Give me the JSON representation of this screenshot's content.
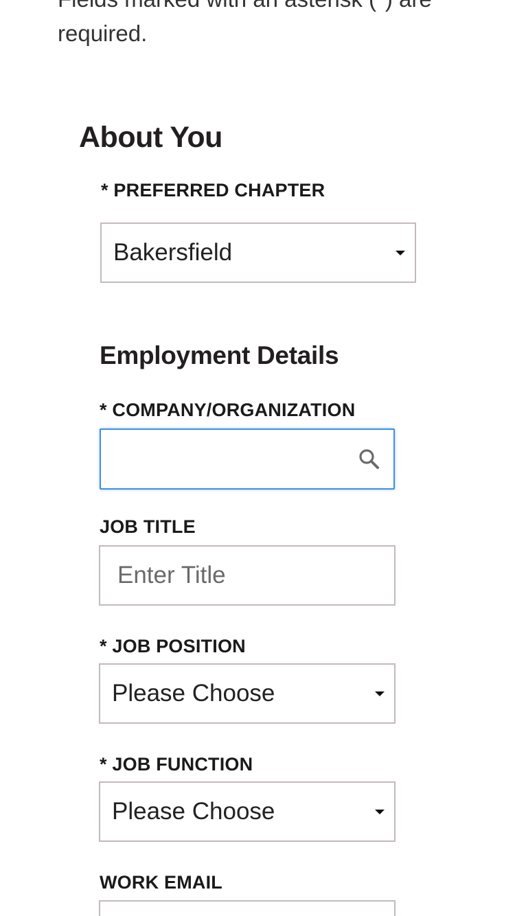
{
  "intro": {
    "required_note": "Fields marked with an asterisk (*) are required."
  },
  "about_you": {
    "heading": "About You",
    "preferred_chapter": {
      "label": "* PREFERRED CHAPTER",
      "value": "Bakersfield"
    }
  },
  "employment": {
    "heading": "Employment Details",
    "company": {
      "label": "* COMPANY/ORGANIZATION",
      "value": ""
    },
    "job_title": {
      "label": "JOB TITLE",
      "placeholder": "Enter Title"
    },
    "job_position": {
      "label": "* JOB POSITION",
      "value": "Please Choose"
    },
    "job_function": {
      "label": "* JOB FUNCTION",
      "value": "Please Choose"
    },
    "work_email": {
      "label": "WORK EMAIL"
    }
  },
  "colors": {
    "focus_border": "#3c8fe6",
    "field_border": "#c4b9bd",
    "text": "#231f20"
  },
  "icons": {
    "select_caret": "chevron-down-icon",
    "company_search": "search-icon"
  }
}
